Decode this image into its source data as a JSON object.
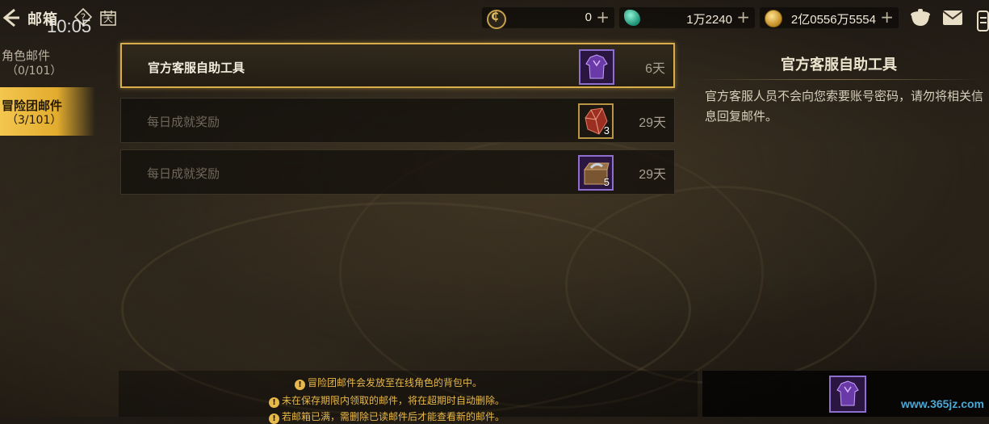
{
  "header": {
    "title": "邮箱",
    "clock": "10:05",
    "help_label": "?",
    "calendar_label": "天"
  },
  "currencies": [
    {
      "name": "coin",
      "value": "0",
      "plus": "+"
    },
    {
      "name": "gem",
      "value": "1万2240",
      "plus": "+"
    },
    {
      "name": "gold",
      "value": "2亿0556万5554",
      "plus": "+"
    }
  ],
  "tabs": [
    {
      "label": "角色邮件",
      "count": "（0/101）"
    },
    {
      "label": "冒险团邮件",
      "count": "（3/101）"
    }
  ],
  "mails": [
    {
      "title": "官方客服自助工具",
      "days": "6天",
      "qty": "",
      "item_icon": "purple-armor-icon",
      "selected": true
    },
    {
      "title": "每日成就奖励",
      "days": "29天",
      "qty": "3",
      "item_icon": "red-crystal-icon",
      "selected": false
    },
    {
      "title": "每日成就奖励",
      "days": "29天",
      "qty": "5",
      "item_icon": "treasure-box-icon",
      "selected": false
    }
  ],
  "detail": {
    "title": "官方客服自助工具",
    "body": "官方客服人员不会向您索要账号密码，请勿将相关信息回复邮件。"
  },
  "notices": [
    "冒险团邮件会发放至在线角色的背包中。",
    "未在保存期限内领取的邮件，将在超期时自动删除。",
    "若邮箱已满，需删除已读邮件后才能查看新的邮件。"
  ],
  "watermark": "www.365jz.com",
  "colors": {
    "accent_gold": "#e2ac2e",
    "selected_border": "#d9ae4a",
    "notice_text": "#e7b84a",
    "item_purple": "#8e6fd0"
  }
}
